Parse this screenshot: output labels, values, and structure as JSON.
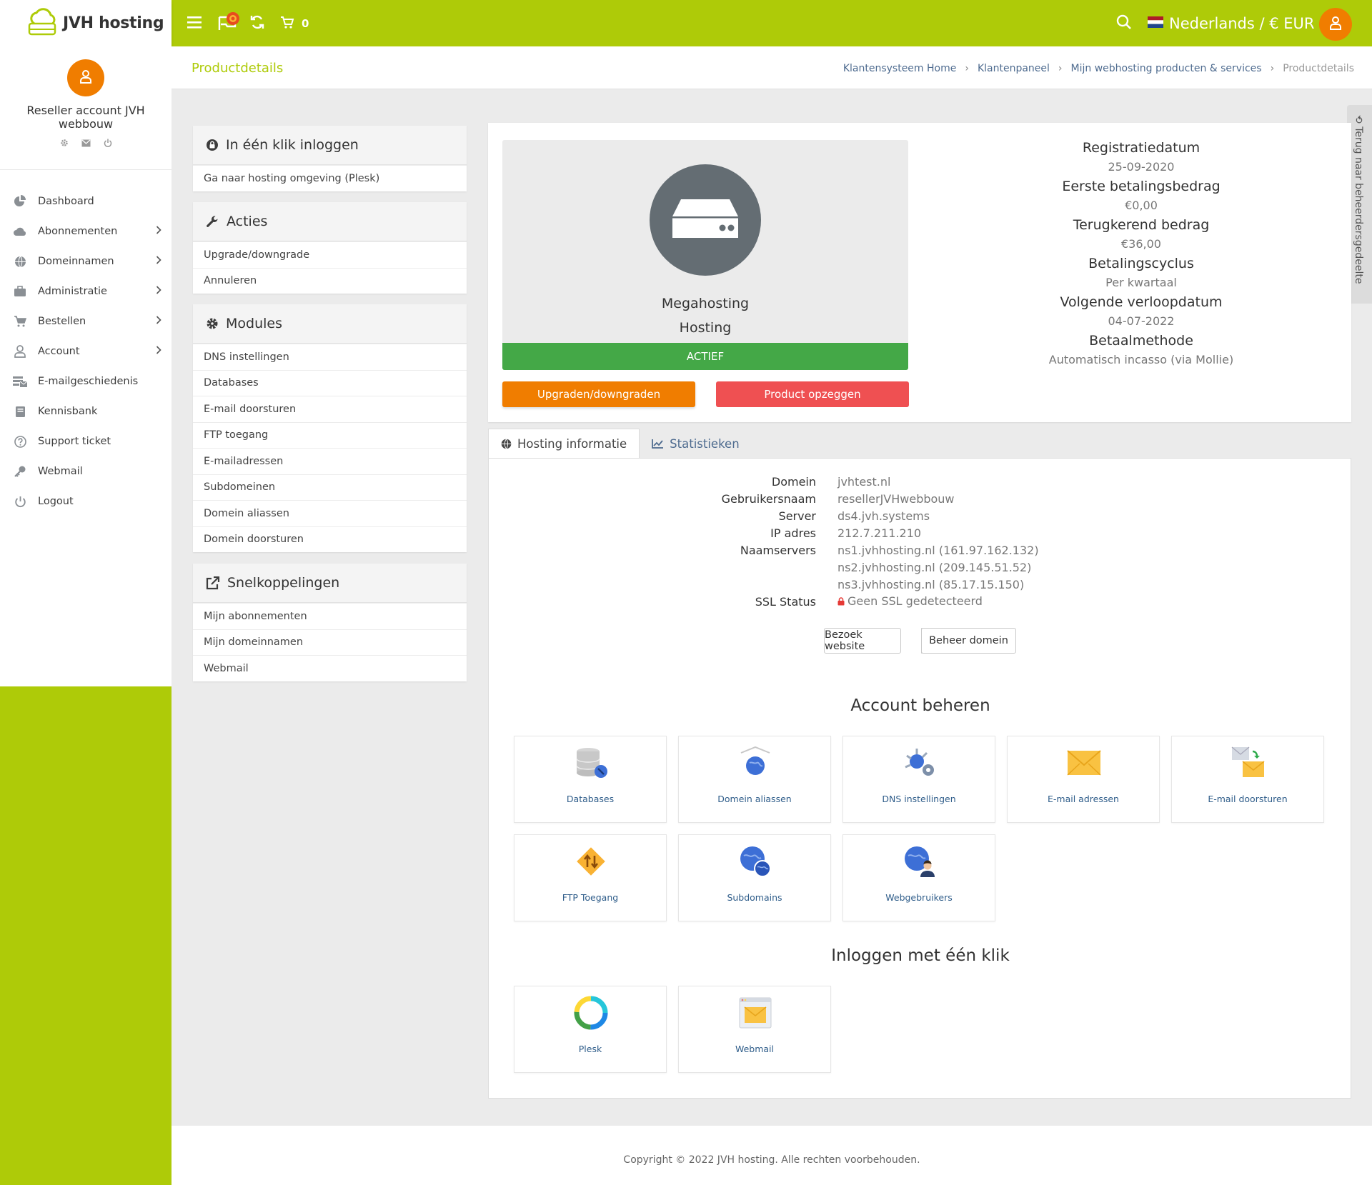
{
  "brand": {
    "name": "JVH hosting"
  },
  "topbar": {
    "cart_count": "0",
    "language": "Nederlands / € EUR"
  },
  "sidebar": {
    "user_name": "Reseller account JVH webbouw",
    "items": [
      {
        "label": "Dashboard",
        "icon": "chart-pie-icon",
        "has_children": false
      },
      {
        "label": "Abonnementen",
        "icon": "cloud-icon",
        "has_children": true
      },
      {
        "label": "Domeinnamen",
        "icon": "globe-icon",
        "has_children": true
      },
      {
        "label": "Administratie",
        "icon": "briefcase-icon",
        "has_children": true
      },
      {
        "label": "Bestellen",
        "icon": "cart-icon",
        "has_children": true
      },
      {
        "label": "Account",
        "icon": "user-icon",
        "has_children": true
      },
      {
        "label": "E-mailgeschiedenis",
        "icon": "mail-history-icon",
        "has_children": false
      },
      {
        "label": "Kennisbank",
        "icon": "book-icon",
        "has_children": false
      },
      {
        "label": "Support ticket",
        "icon": "question-icon",
        "has_children": false
      },
      {
        "label": "Webmail",
        "icon": "key-icon",
        "has_children": false
      },
      {
        "label": "Logout",
        "icon": "power-icon",
        "has_children": false
      }
    ]
  },
  "header": {
    "title": "Productdetails",
    "breadcrumb": [
      "Klantensysteem Home",
      "Klantenpaneel",
      "Mijn webhosting producten & services",
      "Productdetails"
    ]
  },
  "side_tab": {
    "label": "Terug naar beheerdersgedeelte"
  },
  "panels": {
    "login": {
      "title": "In één klik inloggen",
      "items": [
        "Ga naar hosting omgeving (Plesk)"
      ]
    },
    "actions": {
      "title": "Acties",
      "items": [
        "Upgrade/downgrade",
        "Annuleren"
      ]
    },
    "modules": {
      "title": "Modules",
      "items": [
        "DNS instellingen",
        "Databases",
        "E-mail doorsturen",
        "FTP toegang",
        "E-mailadressen",
        "Subdomeinen",
        "Domein aliassen",
        "Domein doorsturen"
      ]
    },
    "shortcuts": {
      "title": "Snelkoppelingen",
      "items": [
        "Mijn abonnementen",
        "Mijn domeinnamen",
        "Webmail"
      ]
    }
  },
  "product": {
    "name": "Megahosting",
    "type": "Hosting",
    "status": "ACTIEF",
    "upgrade_label": "Upgraden/downgraden",
    "cancel_label": "Product opzeggen",
    "info": [
      {
        "label": "Registratiedatum",
        "value": "25-09-2020"
      },
      {
        "label": "Eerste betalingsbedrag",
        "value": "€0,00"
      },
      {
        "label": "Terugkerend bedrag",
        "value": "€36,00"
      },
      {
        "label": "Betalingscyclus",
        "value": "Per kwartaal"
      },
      {
        "label": "Volgende verloopdatum",
        "value": "04-07-2022"
      },
      {
        "label": "Betaalmethode",
        "value": "Automatisch incasso (via Mollie)"
      }
    ]
  },
  "tabs": [
    "Hosting informatie",
    "Statistieken"
  ],
  "hosting_info": {
    "rows": [
      {
        "key": "Domein",
        "value": "jvhtest.nl"
      },
      {
        "key": "Gebruikersnaam",
        "value": "resellerJVHwebbouw"
      },
      {
        "key": "Server",
        "value": "ds4.jvh.systems"
      },
      {
        "key": "IP adres",
        "value": "212.7.211.210"
      },
      {
        "key": "Naamservers",
        "value": "ns1.jvhhosting.nl (161.97.162.132)"
      },
      {
        "key": "",
        "value": "ns2.jvhhosting.nl (209.145.51.52)"
      },
      {
        "key": "",
        "value": "ns3.jvhhosting.nl (85.17.15.150)"
      },
      {
        "key": "SSL Status",
        "value": "Geen SSL gedetecteerd"
      }
    ],
    "visit_label": "Bezoek website",
    "manage_label": "Beheer domein"
  },
  "account_manage": {
    "title": "Account beheren",
    "tiles": [
      {
        "label": "Databases",
        "icon": "database-icon"
      },
      {
        "label": "Domein aliassen",
        "icon": "domain-alias-icon"
      },
      {
        "label": "DNS instellingen",
        "icon": "dns-settings-icon"
      },
      {
        "label": "E-mail adressen",
        "icon": "email-envelope-icon"
      },
      {
        "label": "E-mail doorsturen",
        "icon": "email-forward-icon"
      },
      {
        "label": "FTP Toegang",
        "icon": "ftp-icon"
      },
      {
        "label": "Subdomains",
        "icon": "subdomains-icon"
      },
      {
        "label": "Webgebruikers",
        "icon": "web-users-icon"
      }
    ]
  },
  "one_click": {
    "title": "Inloggen met één klik",
    "tiles": [
      {
        "label": "Plesk",
        "icon": "plesk-icon"
      },
      {
        "label": "Webmail",
        "icon": "webmail-icon"
      }
    ]
  },
  "footer": {
    "text": "Copyright © 2022 JVH hosting. Alle rechten voorbehouden."
  },
  "colors": {
    "brand_green": "#aecb08",
    "accent_orange": "#f07d00",
    "status_green": "#44a847",
    "danger_red": "#ef5052"
  }
}
